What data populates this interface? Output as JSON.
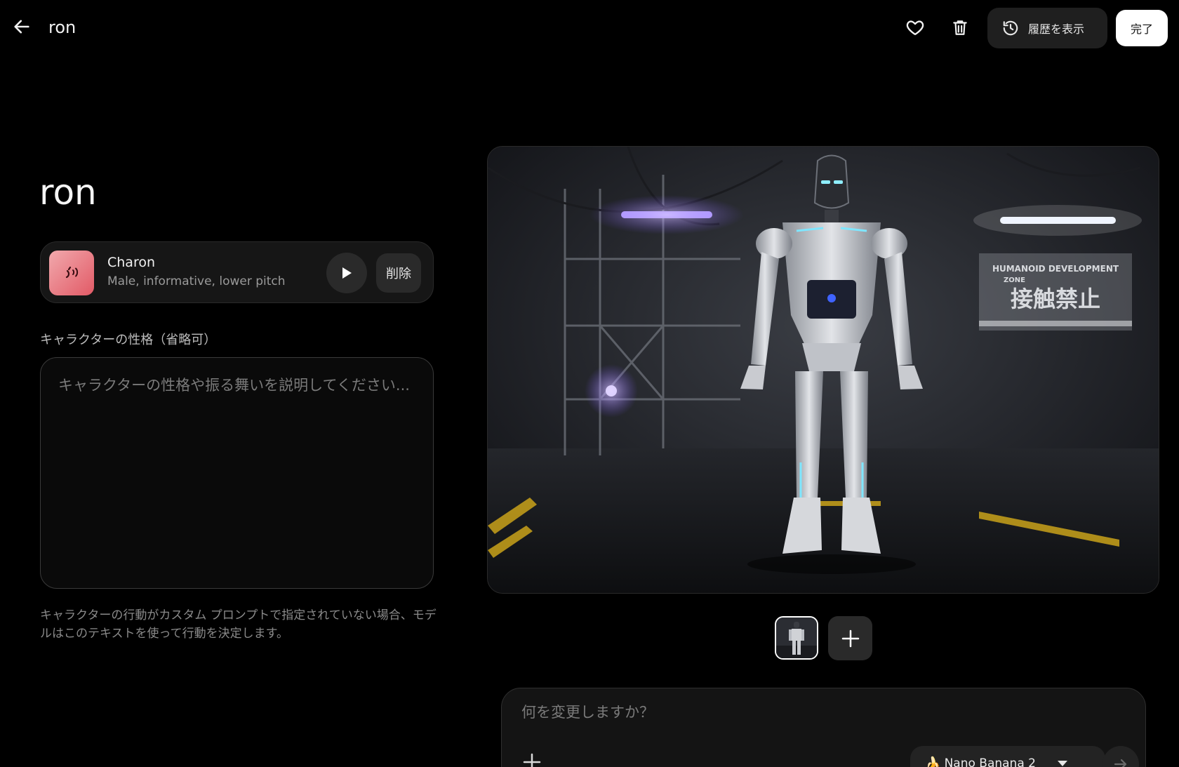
{
  "header": {
    "title": "ron",
    "history_label": "履歴を表示",
    "done_label": "完了"
  },
  "character": {
    "name": "ron"
  },
  "voice": {
    "name": "Charon",
    "description": "Male, informative, lower pitch",
    "remove_label": "削除"
  },
  "personality": {
    "label": "キャラクターの性格（省略可）",
    "placeholder": "キャラクターの性格や振る舞いを説明してください...",
    "value": "",
    "helper": "キャラクターの行動がカスタム プロンプトで指定されていない場合、モデルはこのテキストを使って行動を決定します。"
  },
  "preview": {
    "sign_line1": "HUMANOID DEVELOPMENT",
    "sign_line2": "ZONE",
    "sign_line3": "接触禁止"
  },
  "editor": {
    "placeholder": "何を変更しますか？",
    "model_label": "🍌 Nano Banana 2"
  },
  "colors": {
    "background": "#000000",
    "surface": "#161616",
    "voice_gradient_start": "#f1a9ad",
    "voice_gradient_end": "#e25a66",
    "purple_light": "#a17bff",
    "cyan_glow": "#7fe6ff"
  },
  "icons": {
    "back": "arrow-left-icon",
    "favorite": "heart-outline-icon",
    "delete": "trash-icon",
    "history": "history-clock-icon",
    "voice": "voice-wave-icon",
    "play": "play-icon",
    "add": "plus-icon",
    "dropdown": "caret-down-icon",
    "send": "arrow-right-icon"
  }
}
